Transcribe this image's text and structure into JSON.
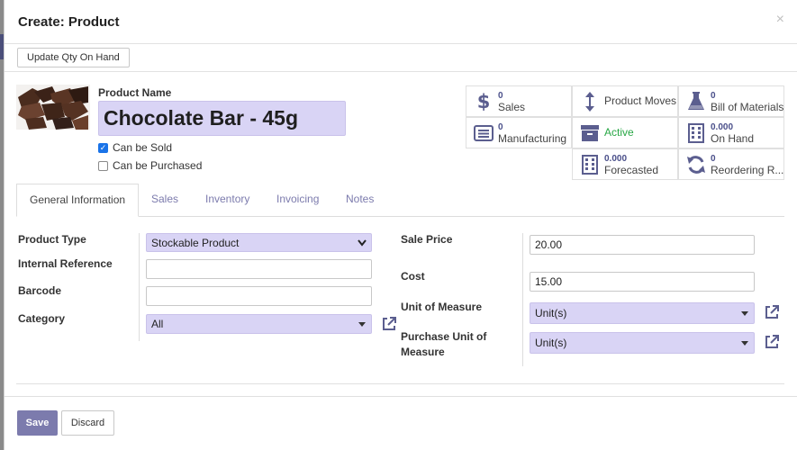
{
  "dialog": {
    "title": "Create: Product",
    "close_glyph": "×"
  },
  "statusbar": {
    "update_qty_label": "Update Qty On Hand"
  },
  "product": {
    "name_label": "Product Name",
    "name_value": "Chocolate Bar - 45g",
    "can_be_sold_label": "Can be Sold",
    "can_be_sold": true,
    "can_be_purchased_label": "Can be Purchased",
    "can_be_purchased": false
  },
  "smart_buttons": {
    "sales": {
      "value": "0",
      "label": "Sales",
      "icon": "dollar-icon"
    },
    "product_moves": {
      "label": "Product Moves",
      "icon": "up-down-arrow-icon"
    },
    "bom": {
      "value": "0",
      "label": "Bill of Materials",
      "icon": "flask-icon"
    },
    "manufacturing": {
      "value": "0",
      "label": "Manufacturing",
      "icon": "list-icon"
    },
    "active": {
      "label": "Active",
      "icon": "archive-icon"
    },
    "on_hand": {
      "value": "0.000",
      "label": "On Hand",
      "icon": "building-icon"
    },
    "forecasted": {
      "value": "0.000",
      "label": "Forecasted",
      "icon": "building-icon"
    },
    "reordering": {
      "value": "0",
      "label": "Reordering R...",
      "icon": "refresh-icon"
    }
  },
  "tabs": [
    "General Information",
    "Sales",
    "Inventory",
    "Invoicing",
    "Notes"
  ],
  "form": {
    "product_type_label": "Product Type",
    "product_type_value": "Stockable Product",
    "internal_reference_label": "Internal Reference",
    "internal_reference_value": "",
    "barcode_label": "Barcode",
    "barcode_value": "",
    "category_label": "Category",
    "category_value": "All",
    "sale_price_label": "Sale Price",
    "sale_price_value": "20.00",
    "cost_label": "Cost",
    "cost_value": "15.00",
    "uom_label": "Unit of Measure",
    "uom_value": "Unit(s)",
    "purchase_uom_label_1": "Purchase Unit of",
    "purchase_uom_label_2": "Measure",
    "purchase_uom_value": "Unit(s)"
  },
  "footer": {
    "save_label": "Save",
    "discard_label": "Discard"
  },
  "colors": {
    "primary": "#7c7bad",
    "select_bg": "#d9d4f5",
    "active_green": "#28a745",
    "icon": "#5b5e8f"
  }
}
